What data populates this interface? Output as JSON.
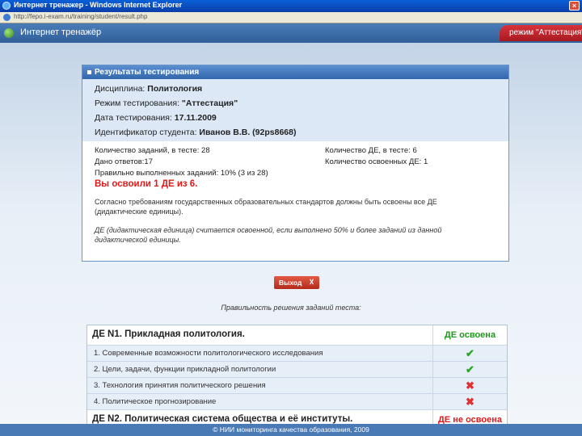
{
  "window": {
    "title": "Интернет тренажер - Windows Internet Explorer",
    "url": "http://fepo.i-exam.ru/training/student/result.php"
  },
  "app": {
    "title": "Интернет тренажёр",
    "mode_badge": "режим \"Аттестация\""
  },
  "results": {
    "header": "Результаты тестирования",
    "discipline_label": "Дисциплина: ",
    "discipline_value": "Политология",
    "mode_label": "Режим тестирования: ",
    "mode_value": "\"Аттестация\"",
    "date_label": "Дата тестирования: ",
    "date_value": "17.11.2009",
    "student_label": "Идентификатор студента: ",
    "student_value": "Иванов В.В. (92ps8668)",
    "stats": {
      "total_tasks": "Количество заданий, в тесте: 28",
      "answers_given": "Дано ответов:17",
      "correct_tasks": "Правильно выполненных заданий: 10% (3 из 28)",
      "total_de": "Количество ДЕ, в тесте: 6",
      "mastered_de": "Количество освоенных ДЕ: 1"
    },
    "result_message": "Вы освоили 1 ДЕ из 6.",
    "note_requirement": "Согласно требованиям государственных образовательных стандартов должны быть освоены все ДЕ (дидактические единицы).",
    "note_definition": "ДЕ (дидактическая единица) считается освоенной, если выполнено 50% и более заданий из данной дидактической единицы."
  },
  "exit_button": {
    "label": "Выход"
  },
  "correctness_caption": "Правильность решения заданий теста:",
  "topics": [
    {
      "title": "ДЕ N1. Прикладная политология.",
      "status": "ДЕ освоена",
      "status_kind": "ok",
      "items": [
        {
          "text": "1. Современные возможности политологического исследования",
          "result": "correct"
        },
        {
          "text": "2. Цели, задачи, функции прикладной политологии",
          "result": "correct"
        },
        {
          "text": "3. Технология принятия политического решения",
          "result": "wrong"
        },
        {
          "text": "4. Политическое прогнозирование",
          "result": "wrong"
        }
      ]
    },
    {
      "title": "ДЕ N2. Политическая система общества и её институты.",
      "status": "ДЕ не освоена",
      "status_kind": "bad",
      "items": []
    }
  ],
  "footer": "© НИИ мониторинга качества образования, 2009",
  "icons": {
    "correct": "check-icon",
    "wrong": "cross-icon"
  },
  "colors": {
    "accent": "#3266ad",
    "ok": "#1d9a1d",
    "bad": "#e01818"
  }
}
